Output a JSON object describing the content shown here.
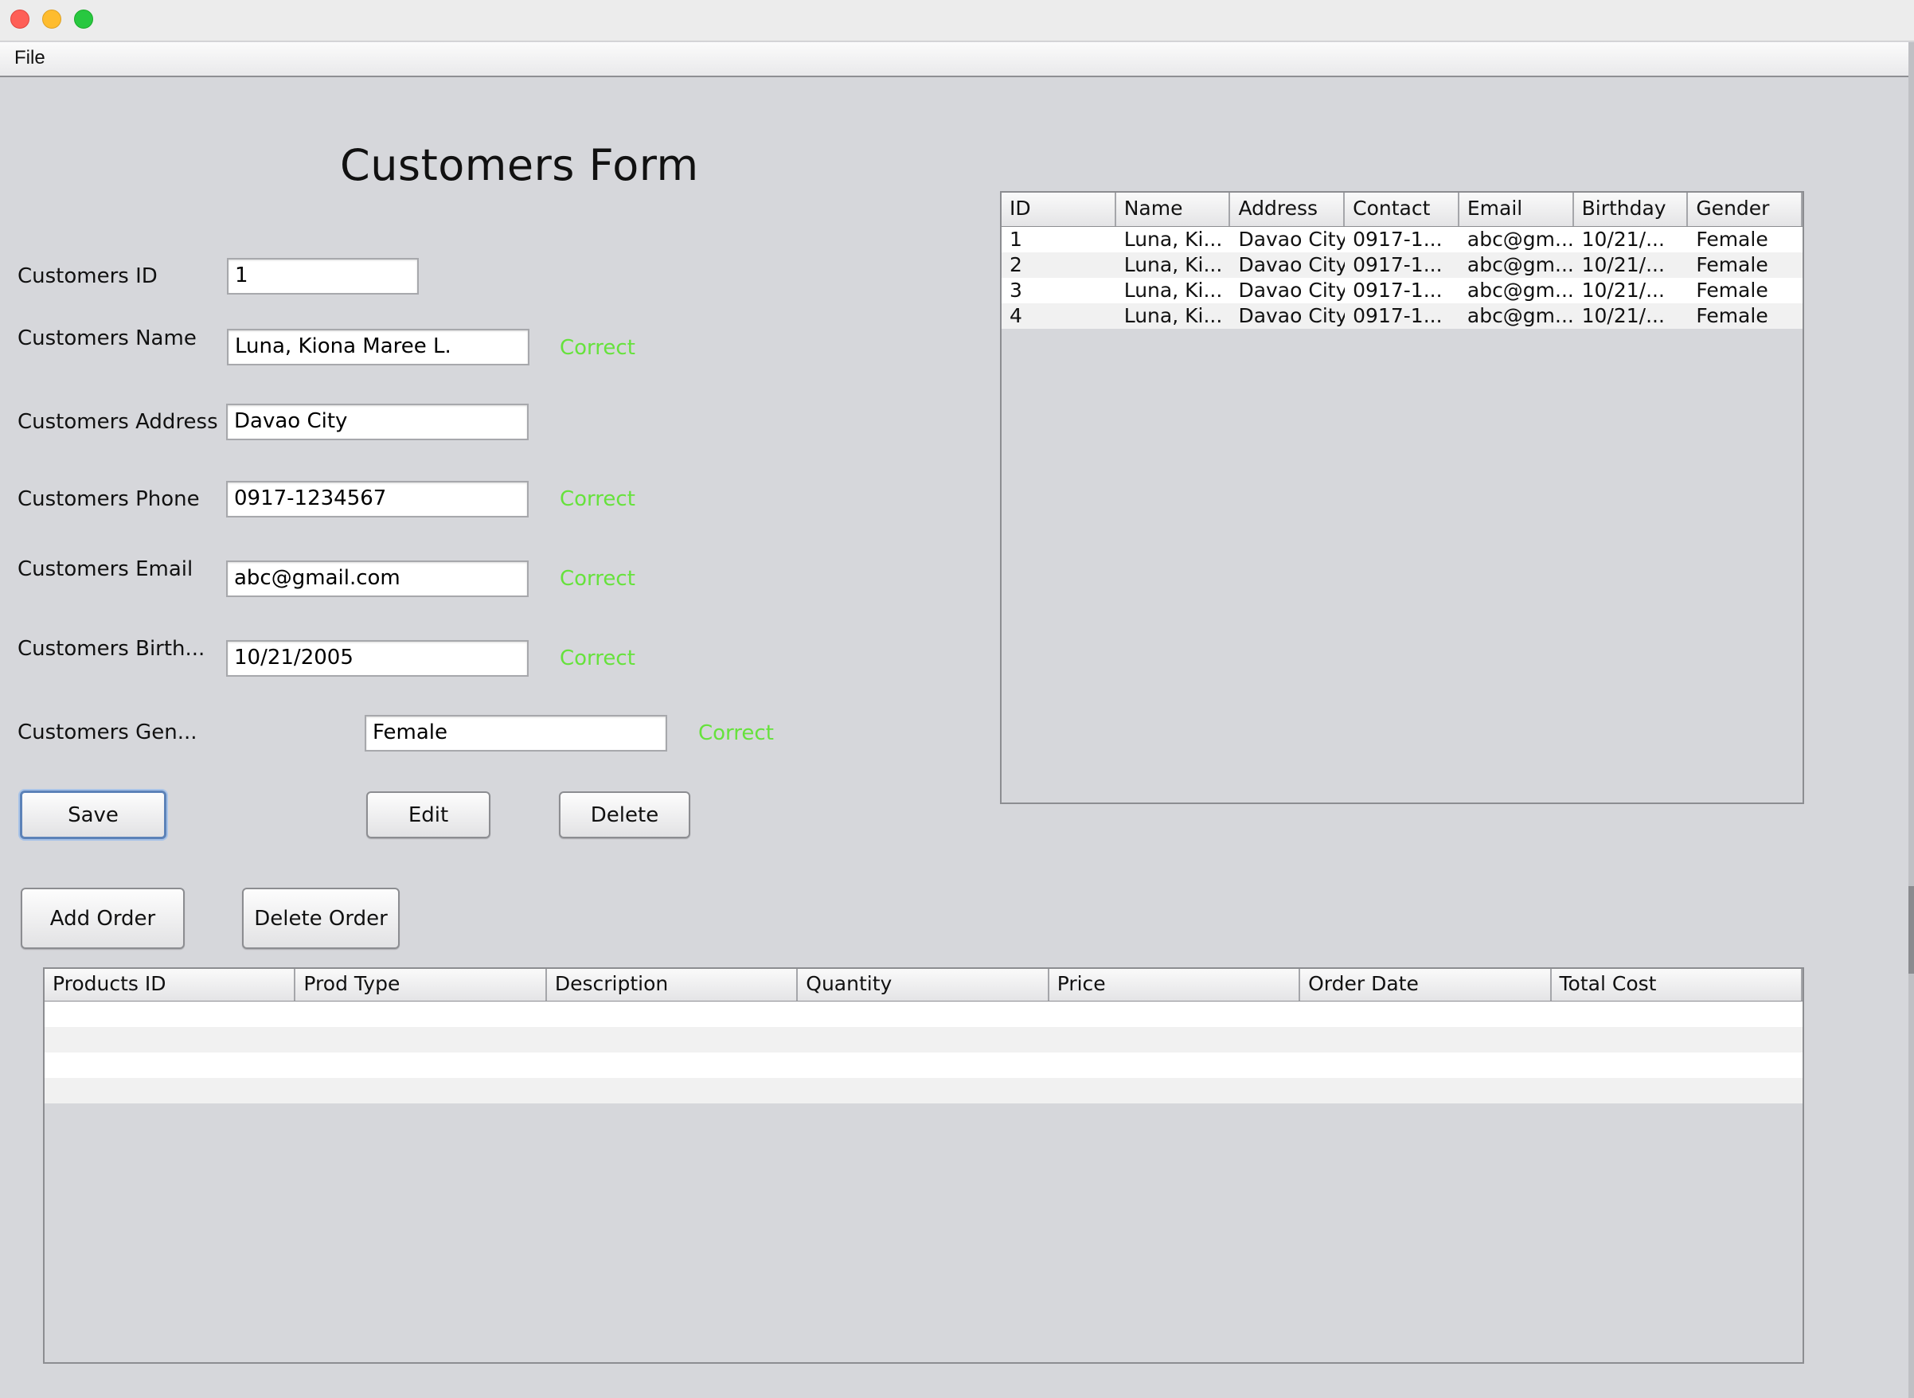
{
  "menu": {
    "file": "File"
  },
  "form": {
    "title": "Customers Form",
    "fields": {
      "id": {
        "label": "Customers ID",
        "value": "1"
      },
      "name": {
        "label": "Customers Name",
        "value": "Luna, Kiona Maree L.",
        "status": "Correct"
      },
      "address": {
        "label": "Customers Address",
        "value": "Davao City"
      },
      "phone": {
        "label": "Customers Phone",
        "value": "0917-1234567",
        "status": "Correct"
      },
      "email": {
        "label": "Customers Email",
        "value": "abc@gmail.com",
        "status": "Correct"
      },
      "birthday": {
        "label": "Customers Birth...",
        "value": "10/21/2005",
        "status": "Correct"
      },
      "gender": {
        "label": "Customers Gen...",
        "value": "Female",
        "status": "Correct"
      }
    },
    "buttons": {
      "save": "Save",
      "edit": "Edit",
      "delete": "Delete",
      "add_order": "Add Order",
      "delete_order": "Delete Order"
    }
  },
  "customers_table": {
    "columns": [
      "ID",
      "Name",
      "Address",
      "Contact",
      "Email",
      "Birthday",
      "Gender"
    ],
    "rows": [
      [
        "1",
        "Luna, Ki...",
        "Davao City",
        "0917-1...",
        "abc@gm...",
        "10/21/...",
        "Female"
      ],
      [
        "2",
        "Luna, Ki...",
        "Davao City",
        "0917-1...",
        "abc@gm...",
        "10/21/...",
        "Female"
      ],
      [
        "3",
        "Luna, Ki...",
        "Davao City",
        "0917-1...",
        "abc@gm...",
        "10/21/...",
        "Female"
      ],
      [
        "4",
        "Luna, Ki...",
        "Davao City",
        "0917-1...",
        "abc@gm...",
        "10/21/...",
        "Female"
      ]
    ]
  },
  "orders_table": {
    "columns": [
      "Products ID",
      "Prod Type",
      "Description",
      "Quantity",
      "Price",
      "Order Date",
      "Total Cost"
    ],
    "rows": []
  },
  "colors": {
    "status_ok": "#66e23c",
    "window_bg": "#d6d7db",
    "default_button_ring": "#5c82b8"
  }
}
